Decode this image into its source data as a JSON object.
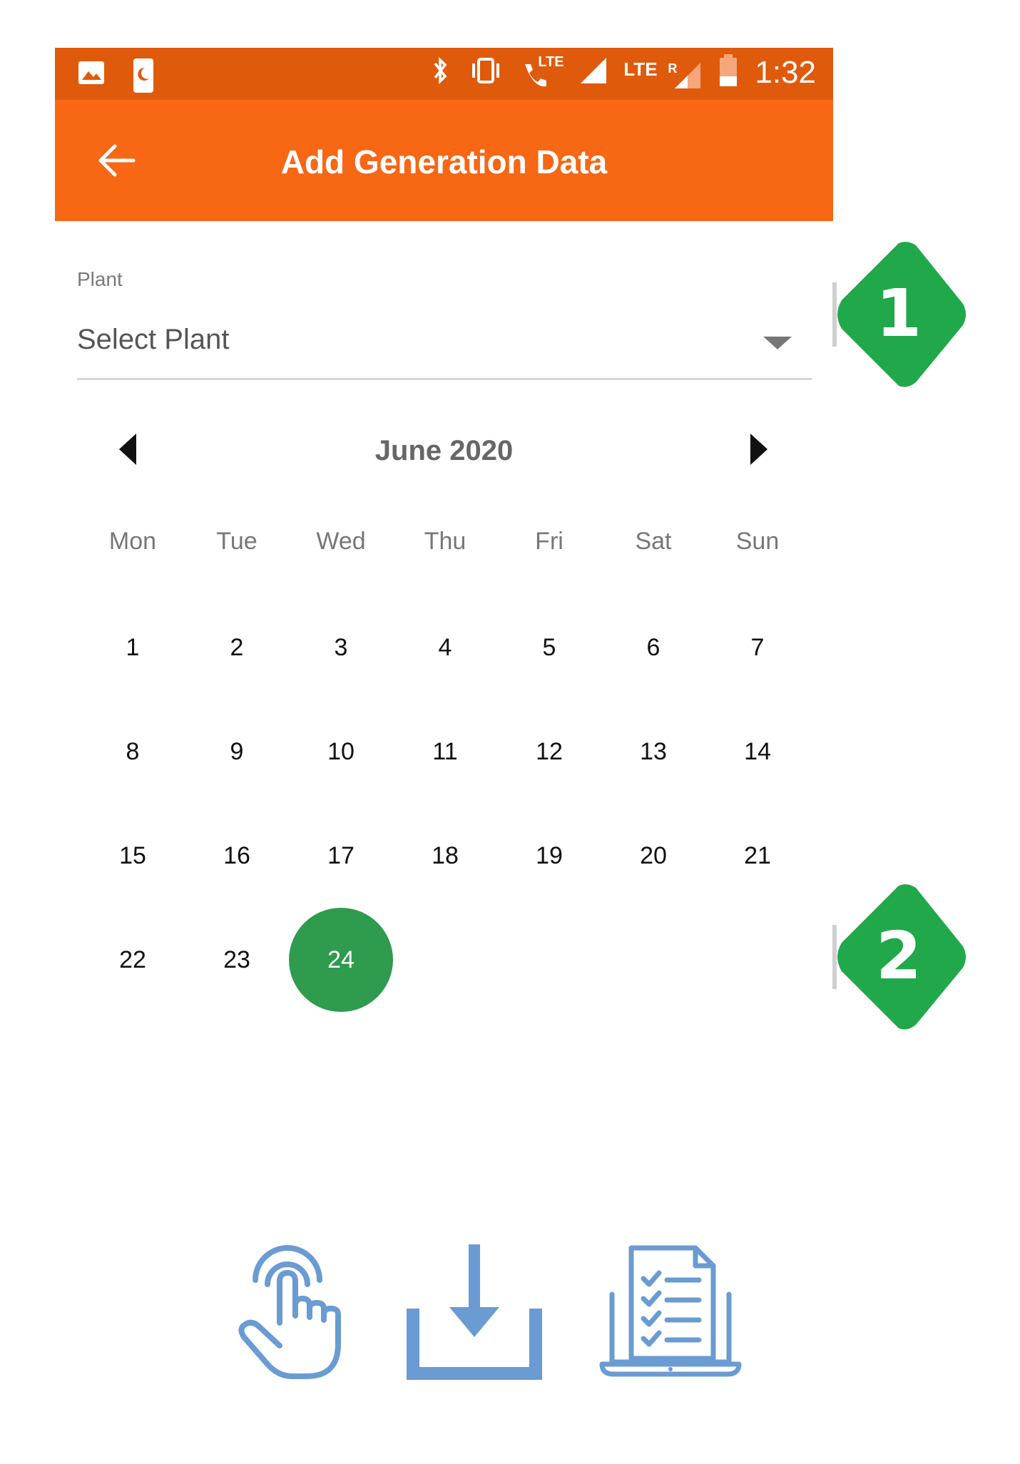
{
  "status_bar": {
    "time": "1:32",
    "icons": [
      "image-icon",
      "notification-moon-icon",
      "bluetooth-icon",
      "vibrate-icon",
      "volte-call-icon",
      "signal-icon",
      "lte-roaming-signal-icon",
      "battery-low-icon"
    ],
    "lte_label_1": "LTE",
    "lte_label_2": "LTE",
    "roaming_label": "R"
  },
  "app_bar": {
    "title": "Add Generation Data",
    "back_icon": "arrow-left-icon"
  },
  "plant_field": {
    "label": "Plant",
    "value": "Select Plant"
  },
  "calendar": {
    "month_label": "June 2020",
    "weekdays": [
      "Mon",
      "Tue",
      "Wed",
      "Thu",
      "Fri",
      "Sat",
      "Sun"
    ],
    "weeks": [
      [
        "1",
        "2",
        "3",
        "4",
        "5",
        "6",
        "7"
      ],
      [
        "8",
        "9",
        "10",
        "11",
        "12",
        "13",
        "14"
      ],
      [
        "15",
        "16",
        "17",
        "18",
        "19",
        "20",
        "21"
      ],
      [
        "22",
        "23",
        "24",
        "",
        "",
        "",
        ""
      ]
    ],
    "selected_day": "24",
    "selected_color": "#2E9B4E"
  },
  "annotations": {
    "step_1": "1",
    "step_2": "2",
    "color": "#21A84A"
  },
  "bottom_icons": [
    "tap-hand-icon",
    "download-icon",
    "laptop-checklist-icon"
  ],
  "colors": {
    "status_bar": "#E05A0C",
    "app_bar": "#F76714",
    "icon_blue": "#6A9BD2"
  }
}
